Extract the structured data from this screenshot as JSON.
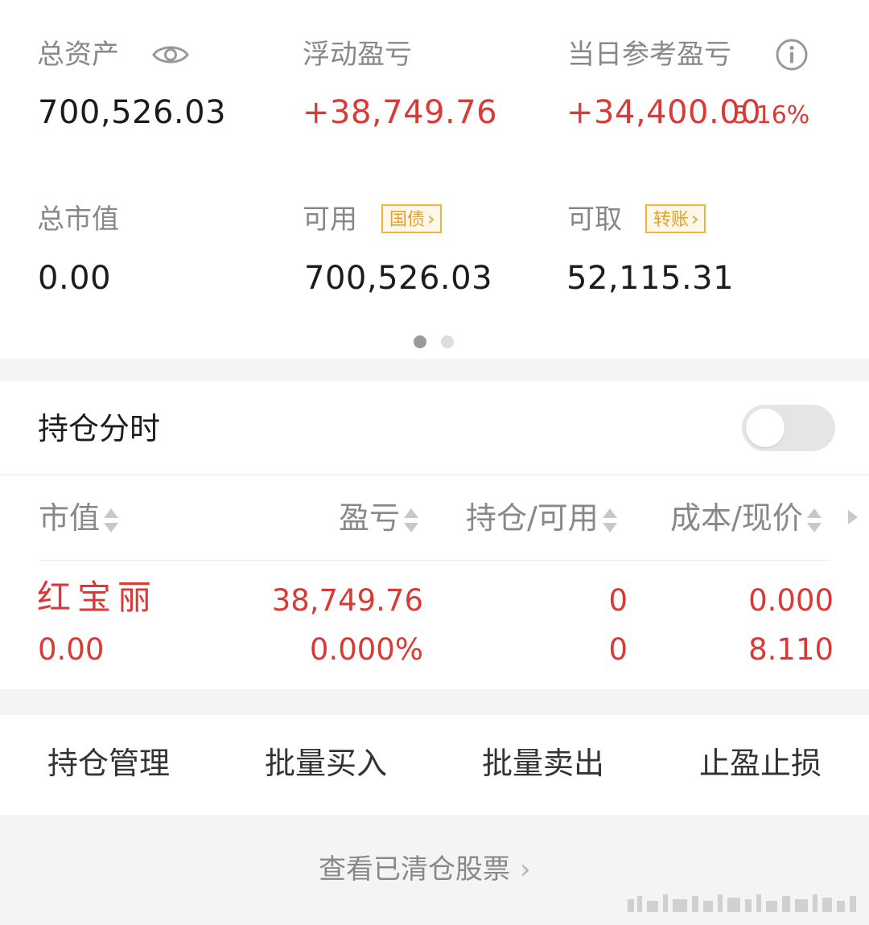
{
  "summary": {
    "total_assets": {
      "label": "总资产",
      "value": "700,526.03"
    },
    "floating_pl": {
      "label": "浮动盈亏",
      "value": "+38,749.76"
    },
    "daily_pl": {
      "label": "当日参考盈亏",
      "value": "+34,400.00",
      "percent": "5.16%"
    },
    "market_value": {
      "label": "总市值",
      "value": "0.00"
    },
    "available": {
      "label": "可用",
      "value": "700,526.03",
      "tag": "国债"
    },
    "withdrawable": {
      "label": "可取",
      "value": "52,115.31",
      "tag": "转账"
    },
    "page_indicator": {
      "total": 2,
      "active": 1
    }
  },
  "holdings_toggle": {
    "label": "持仓分时",
    "enabled": false
  },
  "table": {
    "headers": [
      "市值",
      "盈亏",
      "持仓/可用",
      "成本/现价"
    ],
    "rows": [
      {
        "name": "红宝丽",
        "market_value": "0.00",
        "profit": "38,749.76",
        "profit_pct": "0.000%",
        "position": "0",
        "available": "0",
        "cost": "0.000",
        "price": "8.110"
      }
    ]
  },
  "actions": [
    "持仓管理",
    "批量买入",
    "批量卖出",
    "止盈止损"
  ],
  "footer": {
    "link": "查看已清仓股票"
  },
  "colors": {
    "red": "#d93a35",
    "gray_text": "#888888",
    "tag_border": "#f0b43c",
    "background_band": "#f4f4f4"
  },
  "icons": [
    "eye-icon",
    "info-icon",
    "chevron-right-icon",
    "sort-icon",
    "scroll-right-icon"
  ]
}
